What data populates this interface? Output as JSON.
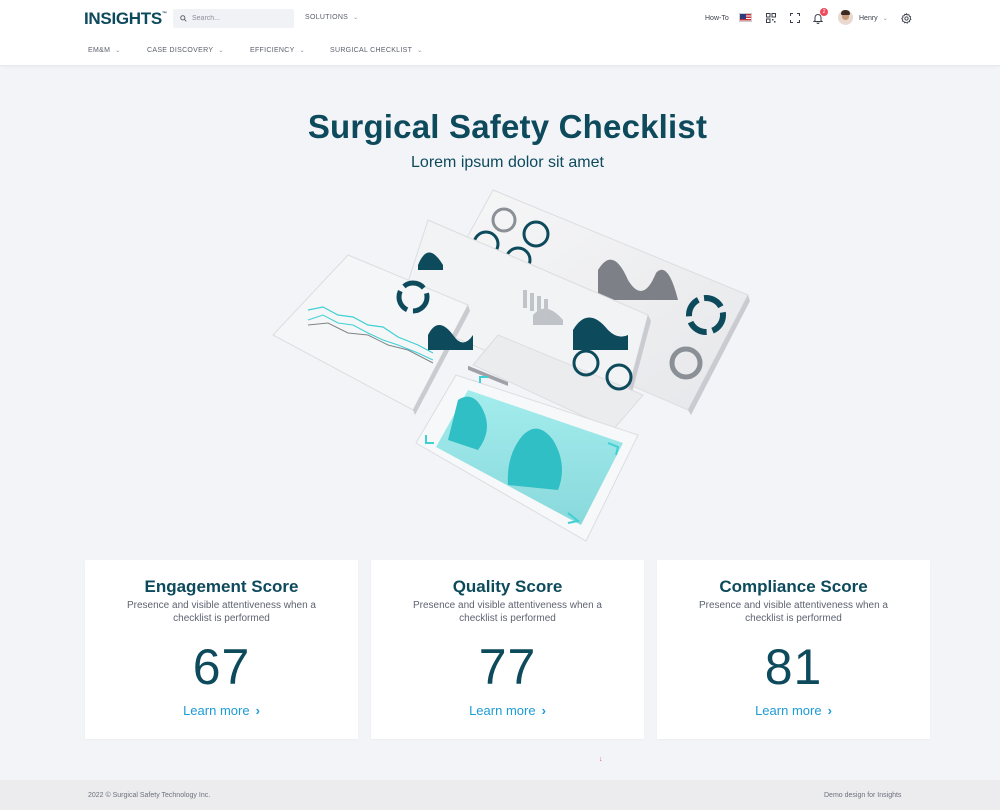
{
  "header": {
    "logo_text": "INSIGHTS",
    "logo_mark": "™",
    "search_placeholder": "Search...",
    "solutions_label": "SOLUTIONS",
    "howto_label": "How-To",
    "notification_count": "2",
    "user_name": "Henry",
    "icons": [
      "search-icon",
      "flag-us-icon",
      "qr-code-icon",
      "fullscreen-icon",
      "bell-icon",
      "avatar",
      "chevron-down-icon",
      "gear-icon"
    ]
  },
  "subnav": {
    "items": [
      {
        "label": "EM&M"
      },
      {
        "label": "CASE DISCOVERY"
      },
      {
        "label": "EFFICIENCY"
      },
      {
        "label": "SURGICAL CHECKLIST"
      }
    ]
  },
  "hero": {
    "title": "Surgical Safety Checklist",
    "subtitle": "Lorem ipsum dolor sit amet"
  },
  "cards": [
    {
      "title": "Engagement Score",
      "description": "Presence and visible attentiveness when a checklist is performed",
      "score": "67",
      "link": "Learn more"
    },
    {
      "title": "Quality Score",
      "description": "Presence and visible attentiveness when a checklist is performed",
      "score": "77",
      "link": "Learn more"
    },
    {
      "title": "Compliance Score",
      "description": "Presence and visible attentiveness when a checklist is performed",
      "score": "81",
      "link": "Learn more"
    }
  ],
  "scroll_indicator": "↓",
  "footer": {
    "copyright": "2022 © Surgical Safety Technology Inc.",
    "credit": "Demo design for Insights"
  },
  "colors": {
    "brand": "#0d4a5c",
    "link": "#1d9bd6",
    "accent_teal": "#3fd0d4",
    "badge": "#ef4b5a",
    "background": "#f3f4f8"
  }
}
